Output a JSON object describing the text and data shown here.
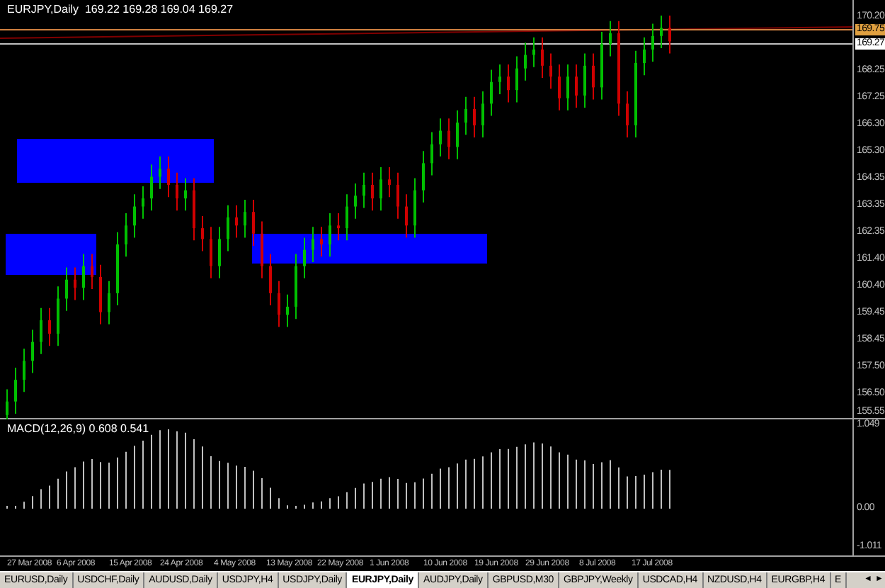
{
  "chart": {
    "symbol_info": "EURJPY,Daily  169.22 169.28 169.04 169.27",
    "price_axis": [
      {
        "text": "170.20",
        "kind": "tick"
      },
      {
        "text": "169.75",
        "kind": "alert"
      },
      {
        "text": "169.27",
        "kind": "bid"
      },
      {
        "text": "168.25",
        "kind": "tick"
      },
      {
        "text": "167.25",
        "kind": "tick"
      },
      {
        "text": "166.30",
        "kind": "tick"
      },
      {
        "text": "165.30",
        "kind": "tick"
      },
      {
        "text": "164.35",
        "kind": "tick"
      },
      {
        "text": "163.35",
        "kind": "tick"
      },
      {
        "text": "162.35",
        "kind": "tick"
      },
      {
        "text": "161.40",
        "kind": "tick"
      },
      {
        "text": "160.40",
        "kind": "tick"
      },
      {
        "text": "159.45",
        "kind": "tick"
      },
      {
        "text": "158.45",
        "kind": "tick"
      },
      {
        "text": "157.50",
        "kind": "tick"
      },
      {
        "text": "156.50",
        "kind": "tick"
      },
      {
        "text": "155.55",
        "kind": "tick"
      }
    ]
  },
  "indicator": {
    "label": "MACD(12,26,9) 0.608 0.541",
    "axis": [
      "1.049",
      "0.00",
      "-1.011"
    ]
  },
  "date_axis": [
    "27 Mar 2008",
    "6 Apr 2008",
    "15 Apr 2008",
    "24 Apr 2008",
    "4 May 2008",
    "13 May 2008",
    "22 May 2008",
    "1 Jun 2008",
    "10 Jun 2008",
    "19 Jun 2008",
    "29 Jun 2008",
    "8 Jul 2008",
    "17 Jul 2008"
  ],
  "tabs": [
    {
      "label": "EURUSD,Daily",
      "selected": false
    },
    {
      "label": "USDCHF,Daily",
      "selected": false
    },
    {
      "label": "AUDUSD,Daily",
      "selected": false
    },
    {
      "label": "USDJPY,H4",
      "selected": false
    },
    {
      "label": "USDJPY,Daily",
      "selected": false
    },
    {
      "label": "EURJPY,Daily",
      "selected": true
    },
    {
      "label": "AUDJPY,Daily",
      "selected": false
    },
    {
      "label": "GBPUSD,M30",
      "selected": false
    },
    {
      "label": "GBPJPY,Weekly",
      "selected": false
    },
    {
      "label": "USDCAD,H4",
      "selected": false
    },
    {
      "label": "NZDUSD,H4",
      "selected": false
    },
    {
      "label": "EURGBP,H4",
      "selected": false
    },
    {
      "label": "E",
      "selected": false
    }
  ],
  "tab_scroll": [
    "◄",
    "►"
  ]
}
